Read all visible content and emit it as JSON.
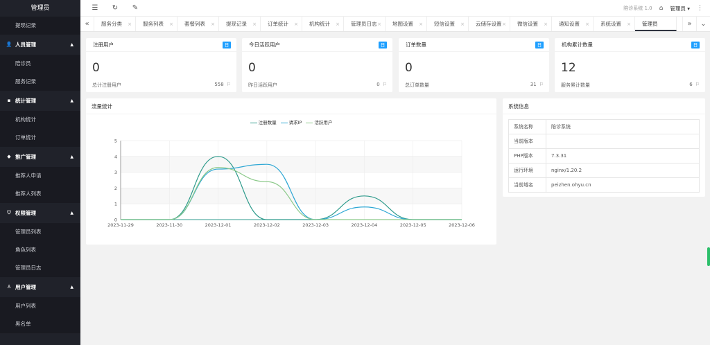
{
  "sidebar": {
    "title": "管理员",
    "entries": [
      {
        "type": "sub",
        "label": "提现记录"
      },
      {
        "type": "group",
        "label": "人员管理",
        "icon": "person-icon"
      },
      {
        "type": "sub",
        "label": "陪诊员"
      },
      {
        "type": "sub",
        "label": "服务记录"
      },
      {
        "type": "group",
        "label": "统计管理",
        "icon": "chat-icon"
      },
      {
        "type": "sub",
        "label": "机构统计"
      },
      {
        "type": "sub",
        "label": "订单统计"
      },
      {
        "type": "group",
        "label": "推广管理",
        "icon": "diamond-icon"
      },
      {
        "type": "sub",
        "label": "推荐人申请"
      },
      {
        "type": "sub",
        "label": "推荐人列表"
      },
      {
        "type": "group",
        "label": "权限管理",
        "icon": "shield-icon"
      },
      {
        "type": "sub",
        "label": "管理员列表"
      },
      {
        "type": "sub",
        "label": "角色列表"
      },
      {
        "type": "sub",
        "label": "管理员日志"
      },
      {
        "type": "group",
        "label": "用户管理",
        "icon": "user-icon"
      },
      {
        "type": "sub",
        "label": "用户列表"
      },
      {
        "type": "sub",
        "label": "黑名单"
      }
    ]
  },
  "header": {
    "system_name": "陪诊系统 1.0",
    "user": "管理员"
  },
  "tabs": [
    "服务分类",
    "服务列表",
    "套餐列表",
    "提现记录",
    "订单统计",
    "机构统计",
    "管理员日志",
    "地图设置",
    "短信设置",
    "云储存设置",
    "微信设置",
    "通知设置",
    "系统设置",
    "管理员"
  ],
  "active_tab": "管理员",
  "stats": [
    {
      "title": "注册用户",
      "badge": "日",
      "value": "0",
      "foot_label": "总计注册用户",
      "foot_value": "558"
    },
    {
      "title": "今日活跃用户",
      "badge": "日",
      "value": "0",
      "foot_label": "昨日活跃用户",
      "foot_value": "0"
    },
    {
      "title": "订单数量",
      "badge": "日",
      "value": "0",
      "foot_label": "总订单数量",
      "foot_value": "31"
    },
    {
      "title": "机构累计数量",
      "badge": "日",
      "value": "12",
      "foot_label": "服务累计数量",
      "foot_value": "6"
    }
  ],
  "traffic_panel": {
    "title": "流量统计"
  },
  "system_panel": {
    "title": "系统信息",
    "rows": [
      {
        "key": "系统名称",
        "value": "陪诊系统"
      },
      {
        "key": "当前版本",
        "value": ""
      },
      {
        "key": "PHP版本",
        "value": "7.3.31"
      },
      {
        "key": "运行环境",
        "value": "nginx/1.20.2"
      },
      {
        "key": "当前域名",
        "value": "peizhen.ohyu.cn"
      }
    ]
  },
  "chart_data": {
    "type": "line",
    "smooth": true,
    "categories": [
      "2023-11-29",
      "2023-11-30",
      "2023-12-01",
      "2023-12-02",
      "2023-12-03",
      "2023-12-04",
      "2023-12-05",
      "2023-12-06"
    ],
    "series": [
      {
        "name": "注册数量",
        "color": "#2f9b8c",
        "values": [
          0,
          0,
          4,
          0,
          0,
          1.5,
          0,
          0
        ]
      },
      {
        "name": "请求IP",
        "color": "#2ea7d4",
        "values": [
          0,
          0,
          3.2,
          3.5,
          0,
          0.8,
          0,
          0
        ]
      },
      {
        "name": "活跃用户",
        "color": "#8cc98a",
        "values": [
          0,
          0,
          3.3,
          2.4,
          0,
          0,
          0,
          0
        ]
      }
    ],
    "ylim": [
      0,
      5
    ],
    "yticks": [
      0,
      1,
      2,
      3,
      4,
      5
    ],
    "grid": true,
    "legend_position": "top-center"
  }
}
